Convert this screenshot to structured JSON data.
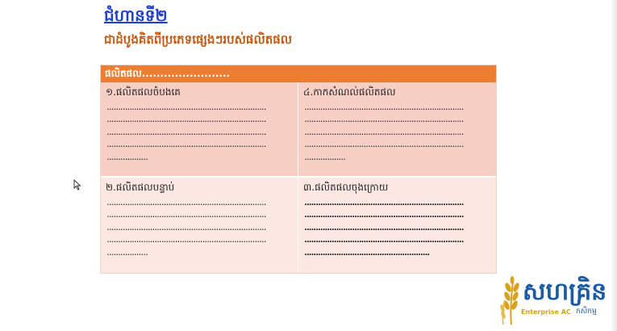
{
  "slide": {
    "step_title": "ជំហានទី២",
    "subtitle": "ជាដំបូងគិតពីប្រភេទផ្សេងៗរបស់ផលិតផល"
  },
  "table": {
    "header": "ផលិតផល........................",
    "cells": [
      {
        "label": "១.ផលិតផលចំបងគេ",
        "lines": [
          "......................................................................",
          "......................................................................",
          "......................................................................",
          "......................................................................",
          ".................."
        ]
      },
      {
        "label": "៤.កាកសំណល់ផលិតផល",
        "lines": [
          "......................................................................",
          "......................................................................",
          "......................................................................",
          "......................................................................",
          ".................."
        ]
      },
      {
        "label": "២.ផលិតផលបន្ទាប់",
        "lines": [
          "......................................................................",
          "......................................................................",
          "......................................................................",
          "......................................................................",
          ".................."
        ]
      },
      {
        "label": "៣.ផលិតផលចុងក្រោយ",
        "lines": [
          "......................................................................",
          "......................................................................",
          "......................................................................",
          "......................................................................",
          "......................................................."
        ]
      }
    ]
  },
  "logo": {
    "text": "សហគ្រិន",
    "sub_en": "Enterprise AC",
    "sub_km": "កសិកម្ម"
  },
  "colors": {
    "title_blue": "#1f3fcf",
    "subtitle_orange": "#c55a11",
    "header_orange": "#ed7d31",
    "cell_top": "#f7cfc4",
    "cell_bottom": "#fbe8e3"
  }
}
